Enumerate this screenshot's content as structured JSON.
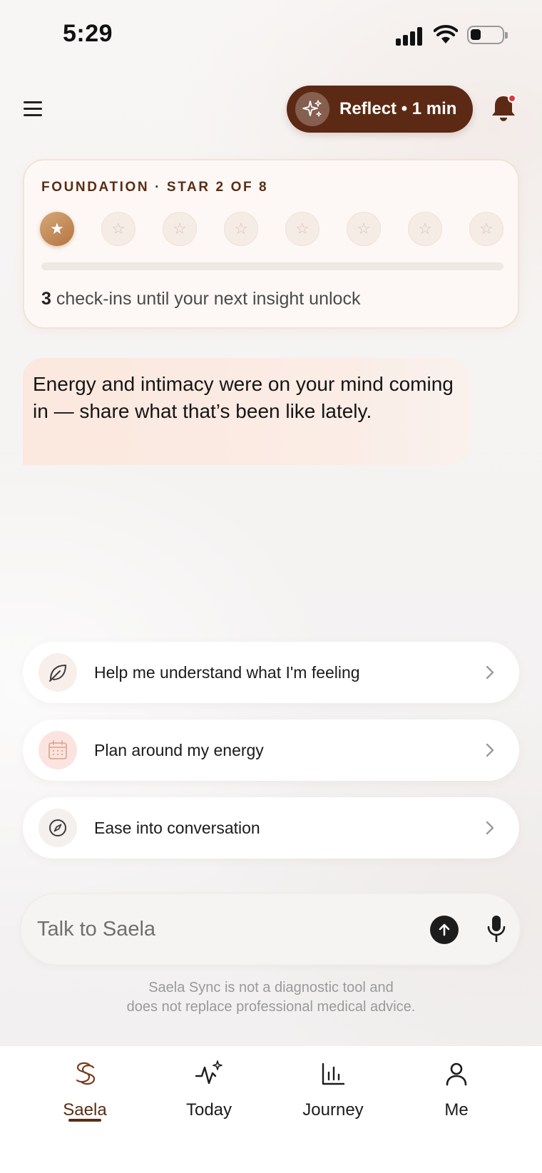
{
  "status_bar": {
    "time": "5:29"
  },
  "header": {
    "reflect_label": "Reflect • 1 min",
    "notification_dot": true
  },
  "progress": {
    "title": "FOUNDATION · STAR 2 OF 8",
    "stars_total": 8,
    "stars_filled": 1,
    "star_glyph": "★",
    "progress_fraction": 0.0,
    "checkins_count": "3",
    "checkins_text": " check-ins until your next insight unlock"
  },
  "message": {
    "text": "Energy and intimacy were on your mind coming in — share what that’s been like lately."
  },
  "suggestions": [
    {
      "label": "Help me understand what I'm feeling",
      "icon": "leaf-icon"
    },
    {
      "label": "Plan around my energy",
      "icon": "calendar-icon"
    },
    {
      "label": "Ease into conversation",
      "icon": "compass-icon"
    }
  ],
  "composer": {
    "placeholder": "Talk to Saela",
    "value": ""
  },
  "disclaimer": {
    "line1": "Saela Sync is not a diagnostic tool and",
    "line2": "does not replace professional medical advice."
  },
  "tabs": [
    {
      "label": "Saela",
      "icon": "saela-logo-icon",
      "active": true
    },
    {
      "label": "Today",
      "icon": "activity-sparkle-icon",
      "active": false
    },
    {
      "label": "Journey",
      "icon": "bar-chart-icon",
      "active": false
    },
    {
      "label": "Me",
      "icon": "person-icon",
      "active": false
    }
  ],
  "colors": {
    "brand_brown": "#5c2a14",
    "accent_copper": "#c8935f",
    "notification_red": "#e2363d",
    "bubble_peach": "#fbe8de"
  }
}
